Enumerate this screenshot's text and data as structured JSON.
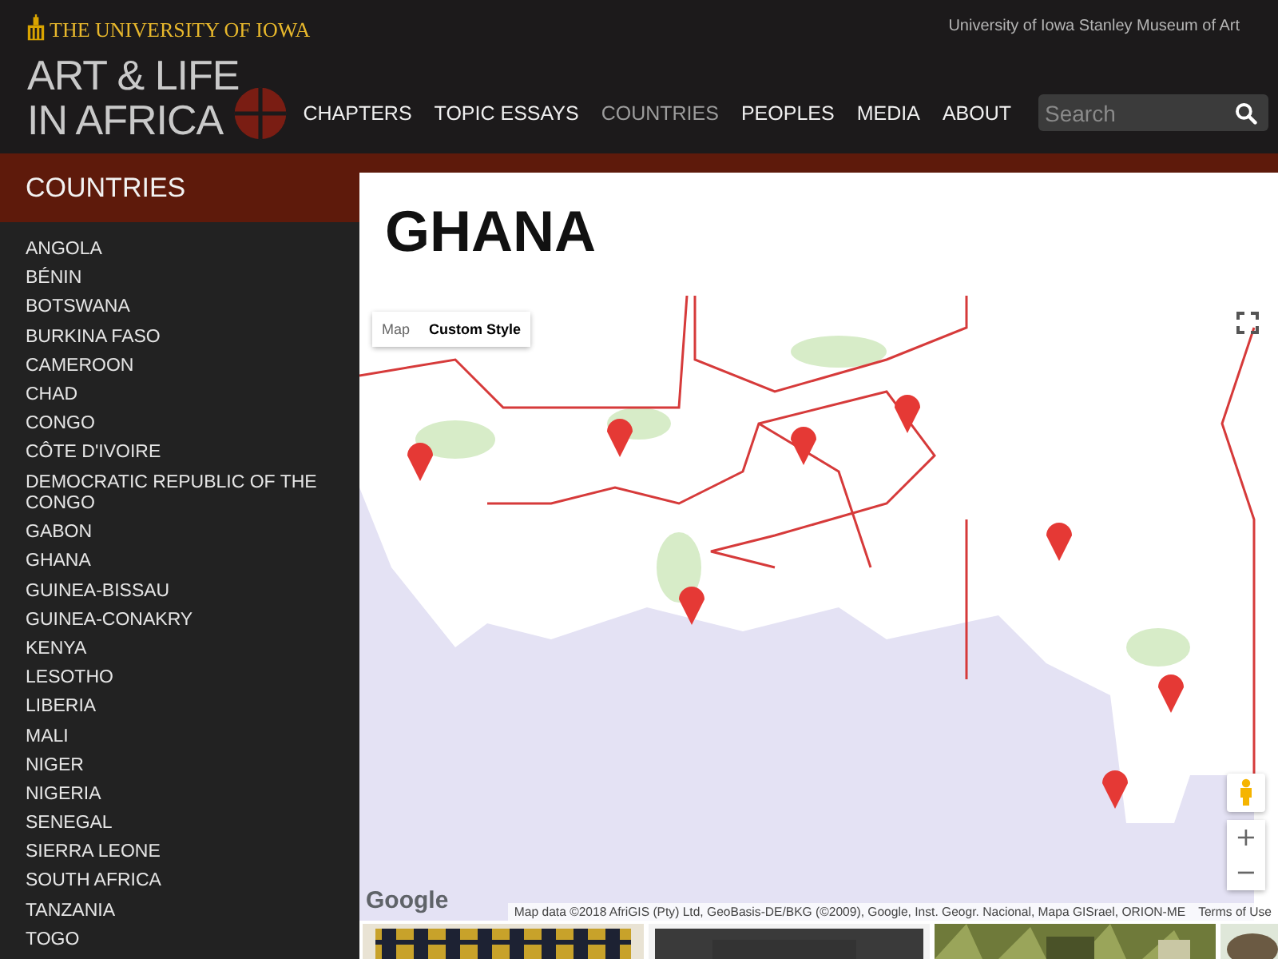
{
  "brand": {
    "university": "THE UNIVERSITY OF IOWA",
    "museum_link": "University of Iowa Stanley Museum of Art",
    "site_title_lines": [
      "ART & LIFE",
      "IN AFRICA"
    ]
  },
  "nav": [
    {
      "label": "CHAPTERS",
      "selected": false
    },
    {
      "label": "TOPIC ESSAYS",
      "selected": false
    },
    {
      "label": "COUNTRIES",
      "selected": true
    },
    {
      "label": "PEOPLES",
      "selected": false
    },
    {
      "label": "MEDIA",
      "selected": false
    },
    {
      "label": "ABOUT",
      "selected": false
    }
  ],
  "search": {
    "placeholder": "Search"
  },
  "sidebar": {
    "heading": "COUNTRIES",
    "items": [
      "ANGOLA",
      "BÉNIN",
      "BOTSWANA",
      "BURKINA FASO",
      "CAMEROON",
      "CHAD",
      "CONGO",
      "CÔTE D'IVOIRE",
      "DEMOCRATIC REPUBLIC OF THE CONGO",
      "GABON",
      "GHANA",
      "GUINEA-BISSAU",
      "GUINEA-CONAKRY",
      "KENYA",
      "LESOTHO",
      "LIBERIA",
      "MALI",
      "NIGER",
      "NIGERIA",
      "SENEGAL",
      "SIERRA LEONE",
      "SOUTH AFRICA",
      "TANZANIA",
      "TOGO"
    ]
  },
  "page": {
    "title": "GHANA"
  },
  "map": {
    "kind": "picture",
    "type_buttons": [
      {
        "label": "Map",
        "selected": false
      },
      {
        "label": "Custom Style",
        "selected": true
      }
    ],
    "zoom_in": "+",
    "zoom_out": "−",
    "logo": "Google",
    "attribution": "Map data ©2018 AfriGIS (Pty) Ltd, GeoBasis-DE/BKG (©2009), Google, Inst. Geogr. Nacional, Mapa GISrael, ORION-ME",
    "terms": "Terms of Use"
  }
}
